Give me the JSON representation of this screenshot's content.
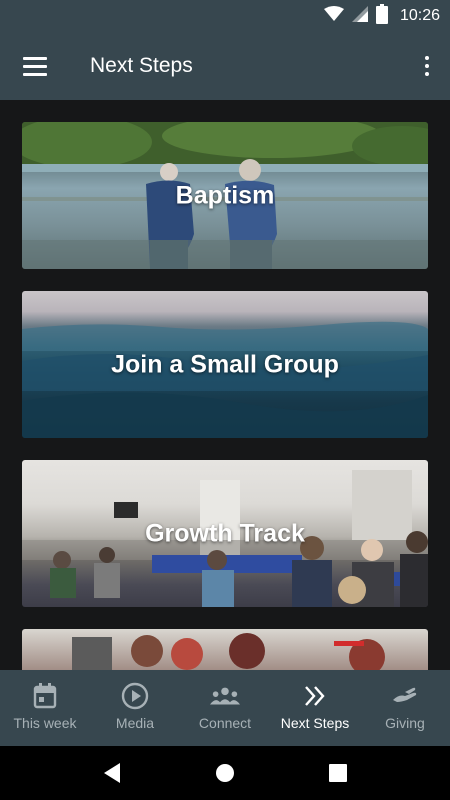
{
  "status_bar": {
    "time": "10:26",
    "icons": [
      "wifi-icon",
      "signal-icon",
      "battery-icon"
    ]
  },
  "app_bar": {
    "title": "Next Steps",
    "menu_icon": "hamburger-menu-icon",
    "overflow_icon": "more-vert-icon"
  },
  "cards": [
    {
      "label": "Baptism",
      "image": "two people wading into a lake"
    },
    {
      "label": "Join a Small Group",
      "image": "ocean wave"
    },
    {
      "label": "Growth Track",
      "image": "people seated at tables in a hall"
    },
    {
      "label": "",
      "image": "people seated indoors (partially visible)"
    }
  ],
  "bottom_nav": {
    "items": [
      {
        "label": "This week",
        "icon": "calendar-icon",
        "active": false
      },
      {
        "label": "Media",
        "icon": "play-circle-icon",
        "active": false
      },
      {
        "label": "Connect",
        "icon": "people-group-icon",
        "active": false
      },
      {
        "label": "Next Steps",
        "icon": "double-chevron-right-icon",
        "active": true
      },
      {
        "label": "Giving",
        "icon": "giving-hand-icon",
        "active": false
      }
    ]
  },
  "colors": {
    "app_bar": "#37474f",
    "background": "#161718",
    "nav_inactive": "#a7b1b6",
    "nav_active": "#ffffff"
  },
  "system_nav": {
    "icons": [
      "back-icon",
      "home-icon",
      "recents-icon"
    ]
  }
}
